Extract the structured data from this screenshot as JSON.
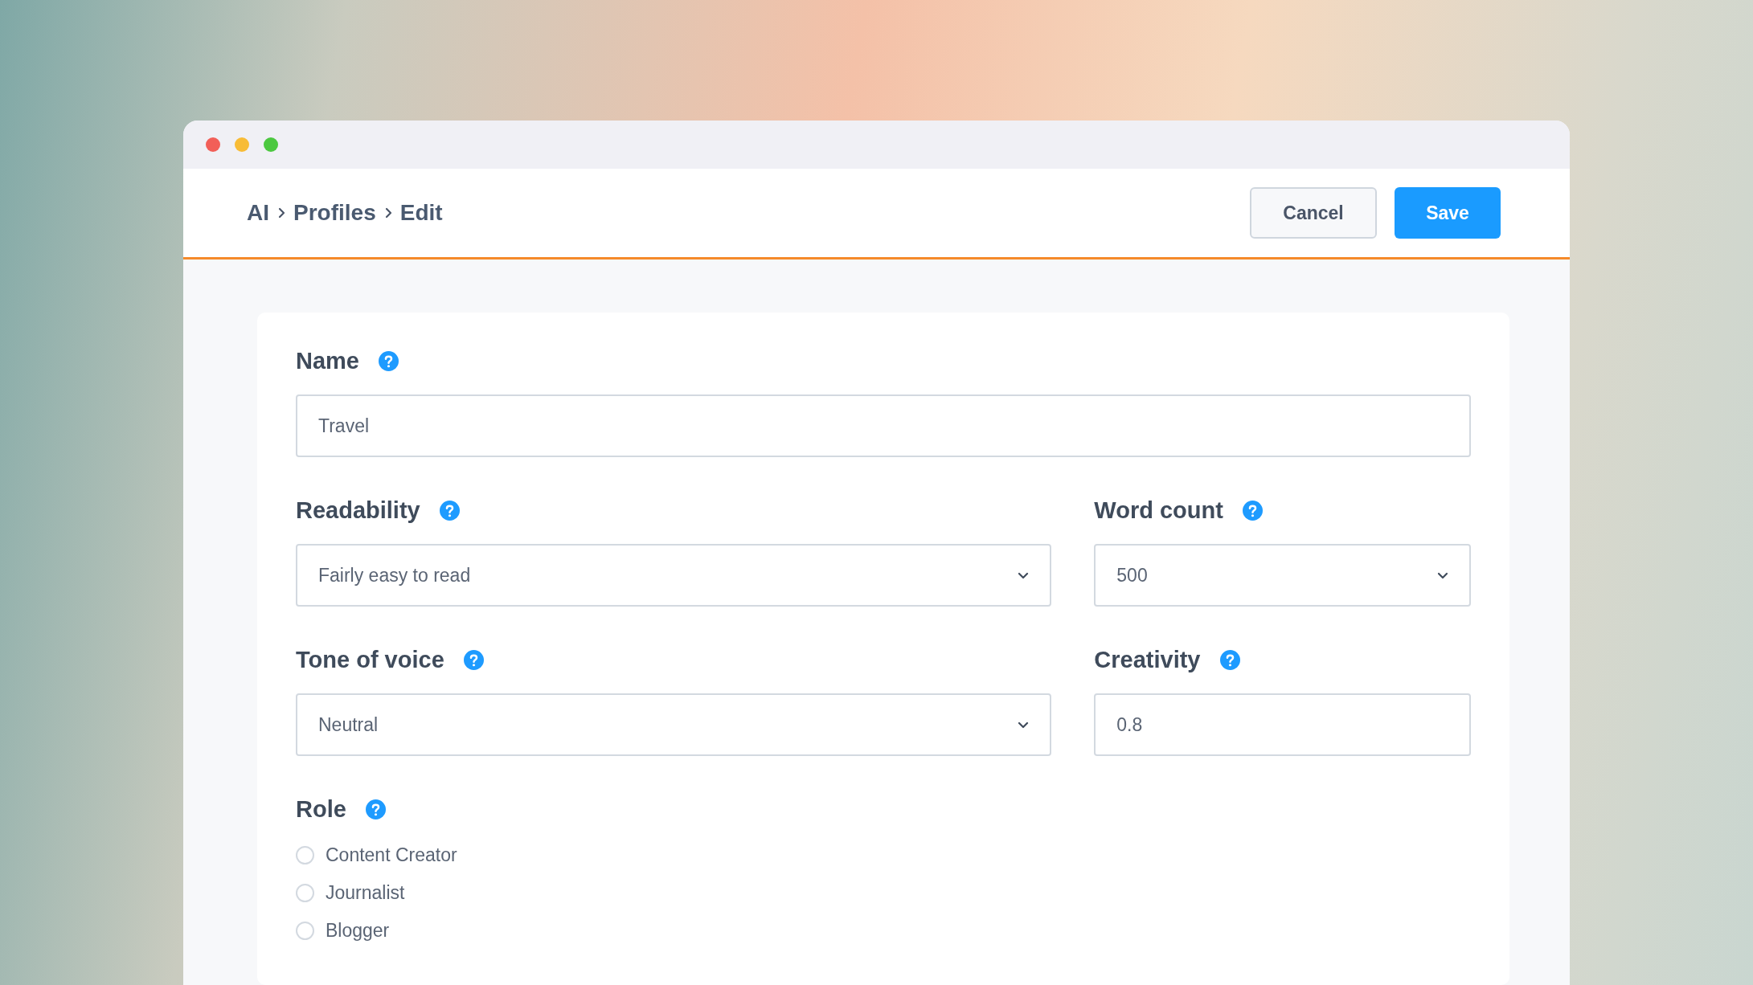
{
  "breadcrumb": [
    "AI",
    "Profiles",
    "Edit"
  ],
  "buttons": [
    {
      "label": "Cancel",
      "kind": "secondary"
    },
    {
      "label": "Save",
      "kind": "primary"
    }
  ],
  "form": {
    "rows": [
      [
        {
          "label": "Name",
          "kind": "text",
          "value": "Travel"
        }
      ],
      [
        {
          "label": "Readability",
          "kind": "select",
          "value": "Fairly easy to read"
        },
        {
          "label": "Word count",
          "kind": "select",
          "value": "500"
        }
      ],
      [
        {
          "label": "Tone of voice",
          "kind": "select",
          "value": "Neutral"
        },
        {
          "label": "Creativity",
          "kind": "text",
          "value": "0.8"
        }
      ],
      [
        {
          "label": "Role",
          "kind": "radio",
          "options": [
            {
              "label": "Content Creator",
              "selected": false
            },
            {
              "label": "Journalist",
              "selected": false
            },
            {
              "label": "Blogger",
              "selected": false
            }
          ]
        }
      ]
    ]
  }
}
